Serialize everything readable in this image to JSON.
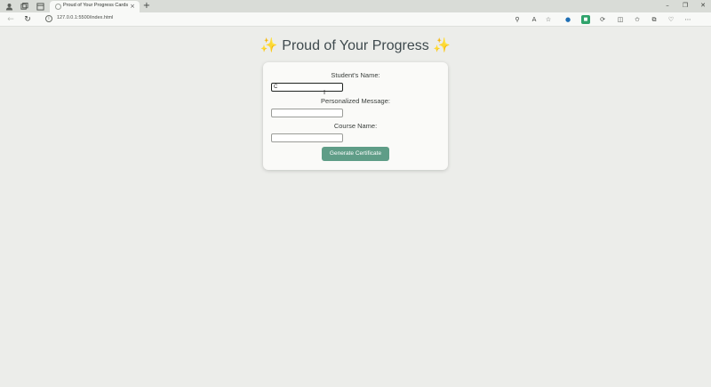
{
  "browser": {
    "tab_title": "Proud of Your Progress Cards",
    "tab_close": "×",
    "new_tab": "+",
    "url": "127.0.0.1:5500/index.html",
    "icons": [
      "profile-icon",
      "collections-icon",
      "tab-actions-icon",
      "back-icon",
      "refresh-icon",
      "info-icon",
      "zoom-icon",
      "read-aloud-icon",
      "favorite-icon",
      "copilot-icon",
      "extension-icon",
      "sync-icon",
      "split-screen-icon",
      "favorites-icon",
      "collections-bar-icon",
      "browser-essentials-icon",
      "more-icon"
    ],
    "window_controls": {
      "minimize": "–",
      "maximize": "❐",
      "close": "✕"
    }
  },
  "page": {
    "heading": "✨ Proud of Your Progress ✨",
    "form": {
      "student_name_label": "Student's Name:",
      "student_name_value": "C",
      "message_label": "Personalized Message:",
      "message_value": "",
      "course_label": "Course Name:",
      "course_value": "",
      "submit_label": "Generate Certificate"
    },
    "colors": {
      "background": "#ecedea",
      "card": "#fafaf8",
      "button": "#5f9d87",
      "heading_text": "#3f4a4e"
    }
  }
}
